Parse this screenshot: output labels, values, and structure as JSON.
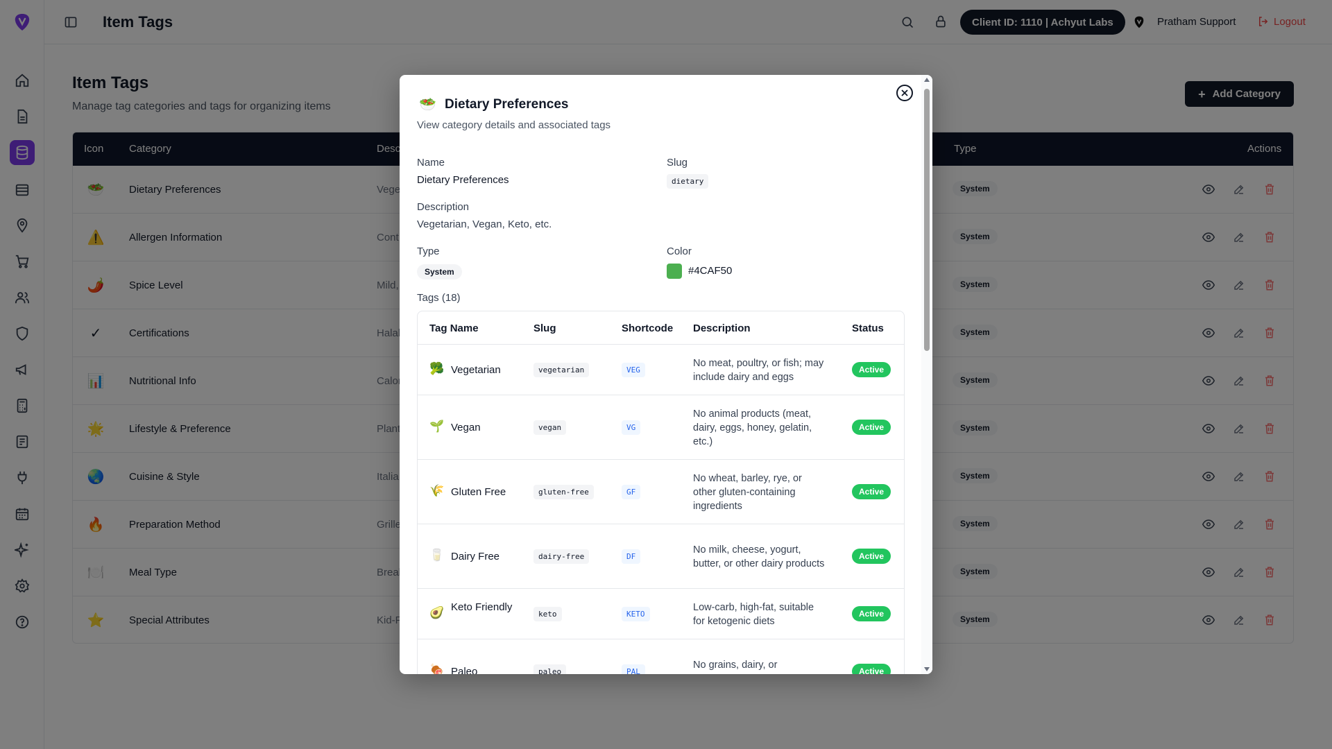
{
  "header": {
    "title": "Item Tags",
    "client_id": "Client ID: 1110 | Achyut Labs",
    "org_name": "Pratham Support",
    "logout": "Logout"
  },
  "sidebar": {
    "items": [
      "home-icon",
      "file-icon",
      "database-icon",
      "layers-icon",
      "map-pin-icon",
      "cart-icon",
      "users-icon",
      "shield-icon",
      "megaphone-icon",
      "calculator-icon",
      "document-icon",
      "plug-icon",
      "calendar-icon",
      "sparkles-icon",
      "gear-icon",
      "help-icon"
    ],
    "active_index": 2,
    "accent": "#7c3aed"
  },
  "page": {
    "title": "Item Tags",
    "subtitle": "Manage tag categories and tags for organizing items",
    "add_button": "Add Category"
  },
  "table": {
    "columns": {
      "icon": "Icon",
      "category": "Category",
      "description": "Desc",
      "type": "Type",
      "actions": "Actions"
    },
    "rows": [
      {
        "icon": "🥗",
        "name": "Dietary Preferences",
        "desc": "Vege",
        "type": "System"
      },
      {
        "icon": "⚠️",
        "name": "Allergen Information",
        "desc": "Cont",
        "type": "System"
      },
      {
        "icon": "🌶️",
        "name": "Spice Level",
        "desc": "Mild,",
        "type": "System"
      },
      {
        "icon": "✓",
        "name": "Certifications",
        "desc": "Halal",
        "type": "System"
      },
      {
        "icon": "📊",
        "name": "Nutritional Info",
        "desc": "Calor",
        "type": "System"
      },
      {
        "icon": "🌟",
        "name": "Lifestyle & Preference",
        "desc": "Plant",
        "type": "System"
      },
      {
        "icon": "🌏",
        "name": "Cuisine & Style",
        "desc": "Italia",
        "type": "System"
      },
      {
        "icon": "🔥",
        "name": "Preparation Method",
        "desc": "Grille",
        "type": "System"
      },
      {
        "icon": "🍽️",
        "name": "Meal Type",
        "desc": "Break",
        "type": "System"
      },
      {
        "icon": "⭐",
        "name": "Special Attributes",
        "desc": "Kid-F",
        "type": "System"
      }
    ]
  },
  "modal": {
    "icon": "🥗",
    "title": "Dietary Preferences",
    "subtitle": "View category details and associated tags",
    "name_label": "Name",
    "name_value": "Dietary Preferences",
    "slug_label": "Slug",
    "slug_value": "dietary",
    "description_label": "Description",
    "description_value": "Vegetarian, Vegan, Keto, etc.",
    "type_label": "Type",
    "type_value": "System",
    "color_label": "Color",
    "color_value": "#4CAF50",
    "tags_label": "Tags (18)",
    "tags_columns": {
      "name": "Tag Name",
      "slug": "Slug",
      "shortcode": "Shortcode",
      "description": "Description",
      "status": "Status"
    },
    "tags": [
      {
        "icon": "🥦",
        "name": "Vegetarian",
        "slug": "vegetarian",
        "shortcode": "VEG",
        "desc": "No meat, poultry, or fish; may include dairy and eggs",
        "status": "Active"
      },
      {
        "icon": "🌱",
        "name": "Vegan",
        "slug": "vegan",
        "shortcode": "VG",
        "desc": "No animal products (meat, dairy, eggs, honey, gelatin, etc.)",
        "status": "Active"
      },
      {
        "icon": "🌾",
        "name": "Gluten Free",
        "slug": "gluten-free",
        "shortcode": "GF",
        "desc": "No wheat, barley, rye, or other gluten-containing ingredients",
        "status": "Active"
      },
      {
        "icon": "🥛",
        "name": "Dairy Free",
        "slug": "dairy-free",
        "shortcode": "DF",
        "desc": "No milk, cheese, yogurt, butter, or other dairy products",
        "status": "Active"
      },
      {
        "icon": "🥑",
        "name": "Keto Friendly",
        "slug": "keto",
        "shortcode": "KETO",
        "desc": "Low-carb, high-fat, suitable for ketogenic diets",
        "status": "Active"
      },
      {
        "icon": "🍖",
        "name": "Paleo",
        "slug": "paleo",
        "shortcode": "PAL",
        "desc": "No grains, dairy, or processed foods; whole",
        "status": "Active"
      }
    ]
  }
}
